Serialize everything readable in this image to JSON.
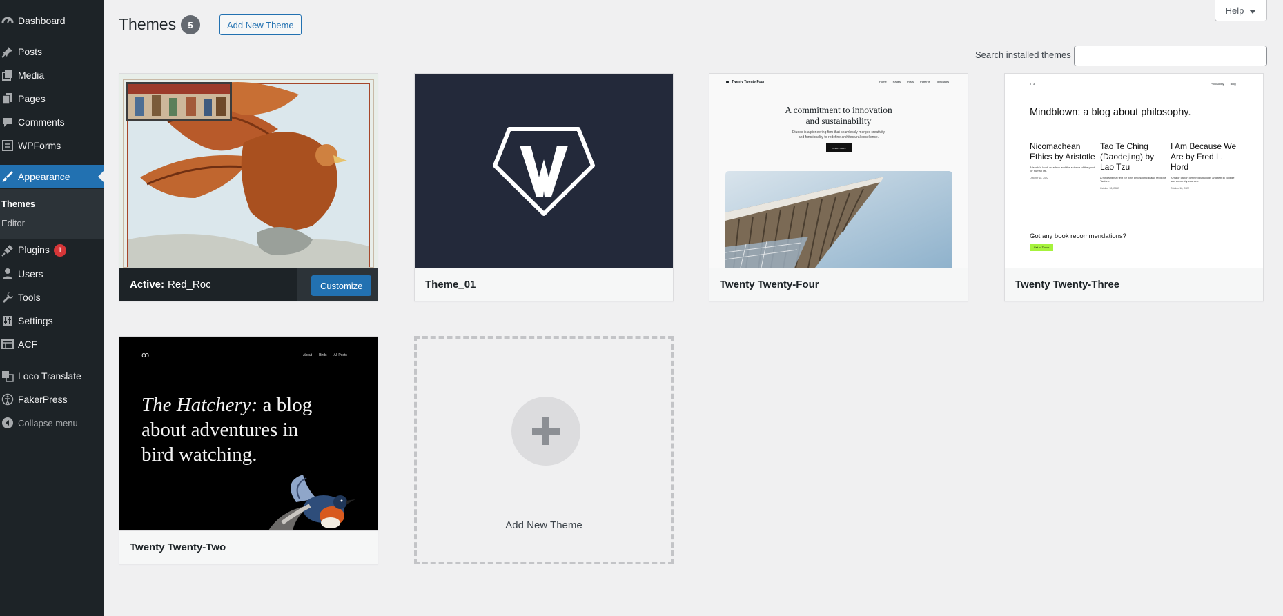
{
  "sidebar": {
    "items": [
      {
        "label": "Dashboard",
        "icon": "dashboard-icon"
      },
      {
        "label": "Posts",
        "icon": "pin-icon"
      },
      {
        "label": "Media",
        "icon": "media-icon"
      },
      {
        "label": "Pages",
        "icon": "pages-icon"
      },
      {
        "label": "Comments",
        "icon": "comments-icon"
      },
      {
        "label": "WPForms",
        "icon": "wpforms-icon"
      },
      {
        "label": "Appearance",
        "icon": "brush-icon"
      },
      {
        "label": "Plugins",
        "icon": "plug-icon",
        "badge": "1"
      },
      {
        "label": "Users",
        "icon": "user-icon"
      },
      {
        "label": "Tools",
        "icon": "wrench-icon"
      },
      {
        "label": "Settings",
        "icon": "settings-icon"
      },
      {
        "label": "ACF",
        "icon": "acf-icon"
      },
      {
        "label": "Loco Translate",
        "icon": "translate-icon"
      },
      {
        "label": "FakerPress",
        "icon": "accessibility-icon"
      },
      {
        "label": "Collapse menu",
        "icon": "collapse-icon"
      }
    ],
    "submenu": [
      {
        "label": "Themes"
      },
      {
        "label": "Editor"
      }
    ]
  },
  "header": {
    "title": "Themes",
    "count": "5",
    "add_new_label": "Add New Theme",
    "help_label": "Help"
  },
  "search": {
    "label": "Search installed themes",
    "value": "",
    "placeholder": ""
  },
  "themes": [
    {
      "name": "Red_Roc",
      "active_prefix": "Active:",
      "customize_label": "Customize"
    },
    {
      "name": "Theme_01"
    },
    {
      "name": "Twenty Twenty-Four"
    },
    {
      "name": "Twenty Twenty-Three"
    },
    {
      "name": "Twenty Twenty-Two"
    }
  ],
  "add_new_card": {
    "label": "Add New Theme"
  },
  "screenshots": {
    "ttf": {
      "site_title": "Twenty Twenty Four",
      "nav": [
        "Home",
        "Pages",
        "Posts",
        "Patterns",
        "Templates"
      ],
      "headline_1": "A commitment to innovation",
      "headline_2": "and sustainability",
      "body_1": "Études is a pioneering firm that seamlessly merges creativity",
      "body_2": "and functionality to redefine architectural excellence.",
      "button": "Learn more"
    },
    "ttt": {
      "site_title": "TT3",
      "nav": [
        "Philosophy",
        "Blog"
      ],
      "headline": "Mindblown: a blog about philosophy.",
      "posts": [
        {
          "title": "Nicomachean Ethics by Aristotle",
          "excerpt": "Aristotle's book on ethics and the science of the good for human life.",
          "date": "October 18, 2022"
        },
        {
          "title": "Tao Te Ching (Daodejing) by Lao Tzu",
          "excerpt": "A fundamental text for both philosophical and religious Taoism.",
          "date": "October 18, 2022"
        },
        {
          "title": "I Am Because We Are by Fred L. Hord",
          "excerpt": "A major canon defining pathology and text in college and university courses.",
          "date": "October 18, 2022"
        }
      ],
      "cta": "Got any book recommendations?",
      "button": "Get In Touch"
    },
    "ttw": {
      "logo": "ꝏ",
      "nav": [
        "About",
        "Birds",
        "All Posts"
      ],
      "headline_italic": "The Hatchery:",
      "headline_rest_1": " a blog",
      "headline_2": "about adventures in",
      "headline_3": "bird watching."
    },
    "theme01": {
      "logo_letter": "W"
    }
  },
  "colors": {
    "sidebar_bg": "#1d2327",
    "accent": "#2271b1",
    "badge": "#d63638",
    "page_bg": "#f0f0f1"
  }
}
